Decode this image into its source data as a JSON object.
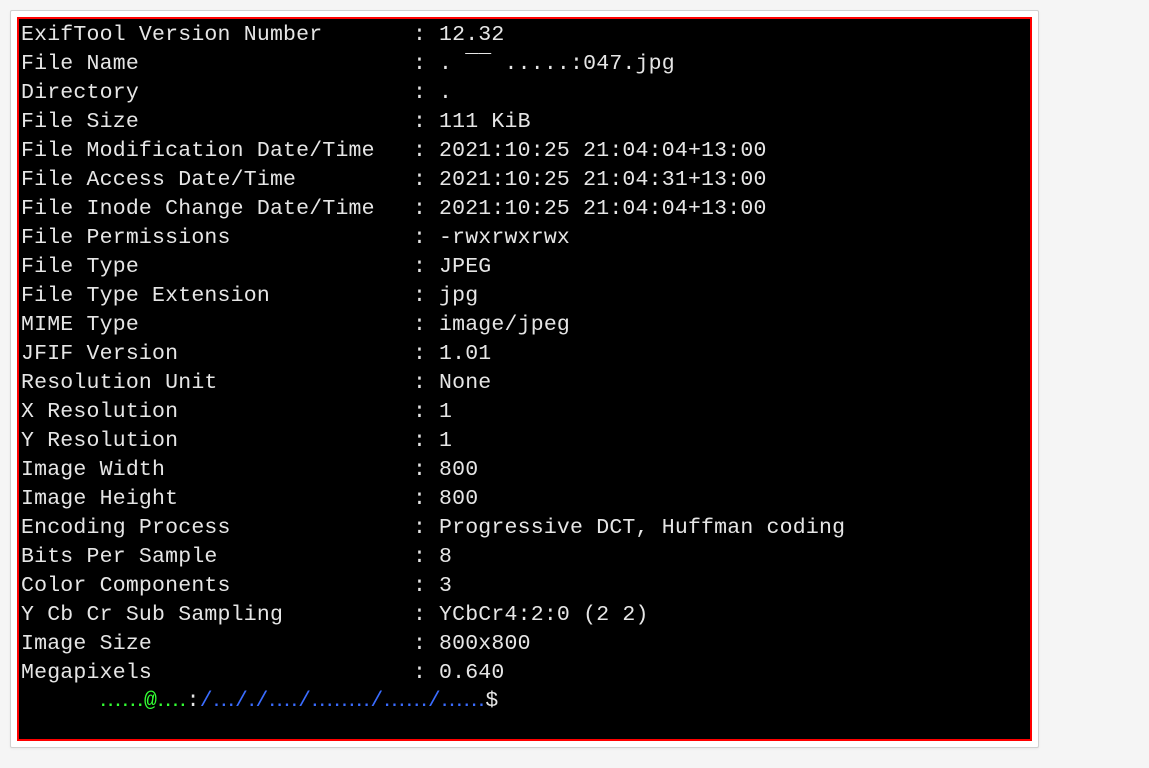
{
  "separator": ":",
  "rows": [
    {
      "label": "ExifTool Version Number",
      "value": "12.32"
    },
    {
      "label": "File Name",
      "value": ". ‾‾ .....:047.jpg"
    },
    {
      "label": "Directory",
      "value": "."
    },
    {
      "label": "File Size",
      "value": "111 KiB"
    },
    {
      "label": "File Modification Date/Time",
      "value": "2021:10:25 21:04:04+13:00"
    },
    {
      "label": "File Access Date/Time",
      "value": "2021:10:25 21:04:31+13:00"
    },
    {
      "label": "File Inode Change Date/Time",
      "value": "2021:10:25 21:04:04+13:00"
    },
    {
      "label": "File Permissions",
      "value": "-rwxrwxrwx"
    },
    {
      "label": "File Type",
      "value": "JPEG"
    },
    {
      "label": "File Type Extension",
      "value": "jpg"
    },
    {
      "label": "MIME Type",
      "value": "image/jpeg"
    },
    {
      "label": "JFIF Version",
      "value": "1.01"
    },
    {
      "label": "Resolution Unit",
      "value": "None"
    },
    {
      "label": "X Resolution",
      "value": "1"
    },
    {
      "label": "Y Resolution",
      "value": "1"
    },
    {
      "label": "Image Width",
      "value": "800"
    },
    {
      "label": "Image Height",
      "value": "800"
    },
    {
      "label": "Encoding Process",
      "value": "Progressive DCT, Huffman coding"
    },
    {
      "label": "Bits Per Sample",
      "value": "8"
    },
    {
      "label": "Color Components",
      "value": "3"
    },
    {
      "label": "Y Cb Cr Sub Sampling",
      "value": "YCbCr4:2:0 (2 2)"
    },
    {
      "label": "Image Size",
      "value": "800x800"
    },
    {
      "label": "Megapixels",
      "value": "0.640"
    }
  ],
  "prompt": {
    "user_host": "․․․․․․@․․․․",
    "colon": ":",
    "path": "/․․․/․/․․․․/․․․․․․․․/․․․․․․/․․․․․․",
    "suffix": "$"
  }
}
